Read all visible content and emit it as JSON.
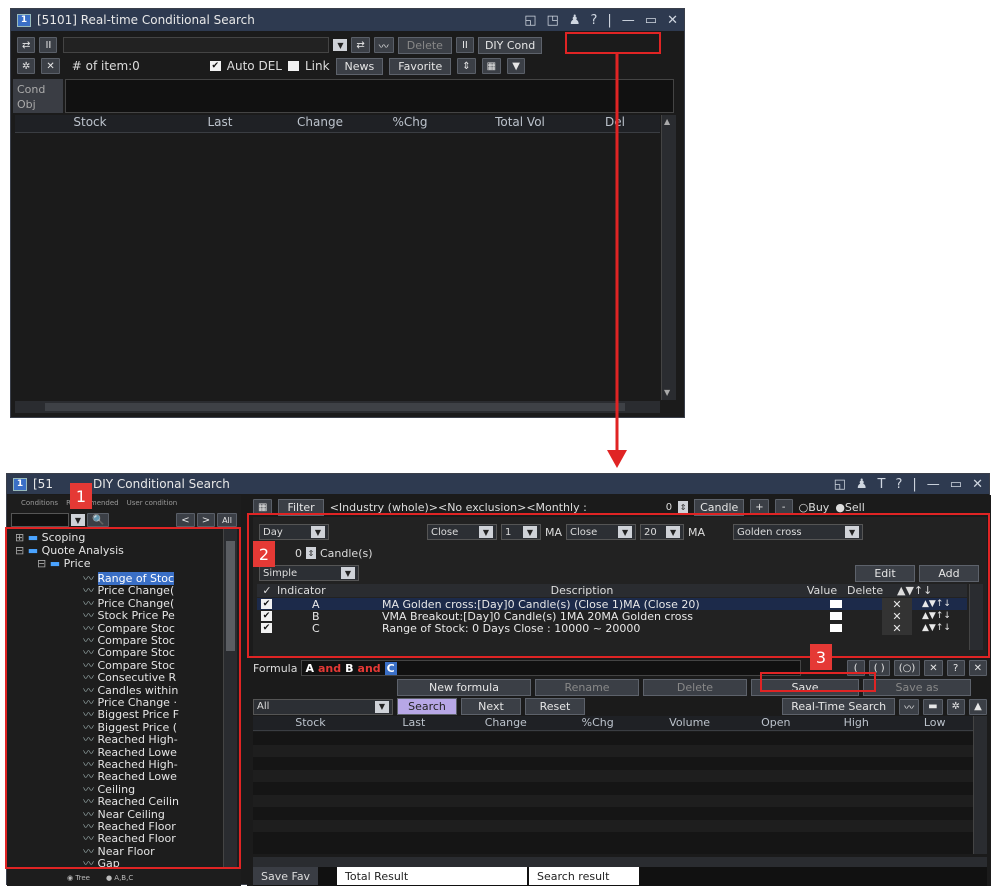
{
  "top": {
    "num": "1",
    "title": "[5101] Real-time Conditional Search",
    "ctrl": [
      "◱",
      "◳",
      "♟",
      "?",
      "|",
      "—",
      "▭",
      "✕"
    ],
    "toolbar1": {
      "swap": "⇄",
      "pause": "II",
      "arrow": "▼",
      "swap2": "⇄",
      "chart": "〰",
      "delete": "Delete",
      "pause2": "II",
      "diy": "DIY Cond"
    },
    "toolbar2": {
      "gear": "✲",
      "x": "✕",
      "items": "# of item:0",
      "autodel": "Auto DEL",
      "link": "Link",
      "news": "News",
      "favorite": "Favorite",
      "updown": "⇕",
      "more": "▦",
      "arrow": "▼"
    },
    "condobj": [
      "Cond",
      "Obj"
    ],
    "columns": [
      "Stock",
      "Last",
      "Change",
      "%Chg",
      "Total Vol",
      "Del"
    ]
  },
  "bottom": {
    "num": "1",
    "title_prefix": "[51",
    "title_suffix": "DIY Conditional Search",
    "ctrl": [
      "◱",
      "♟",
      "T",
      "?",
      "|",
      "—",
      "▭",
      "✕"
    ],
    "lefttabs": [
      "Conditions",
      "Recommended",
      "User condition"
    ],
    "leftbtns": [
      "<",
      ">",
      "All"
    ],
    "tree_roots": [
      "Scoping",
      "Quote Analysis",
      "Price"
    ],
    "tree_items": [
      "Range of Stoc",
      "Price Change(",
      "Price Change(",
      "Stock Price Pe",
      "Compare Stoc",
      "Compare Stoc",
      "Compare Stoc",
      "Compare Stoc",
      "Consecutive R",
      "Candles within",
      "Price Change ·",
      "Biggest Price F",
      "Biggest Price (",
      "Reached High-",
      "Reached Lowe",
      "Reached High-",
      "Reached Lowe",
      "Ceiling",
      "Reached Ceilin",
      "Near Ceiling",
      "Reached Floor",
      "Reached Floor",
      "Near Floor",
      "Gap"
    ],
    "radios": [
      "Tree",
      "A,B,C"
    ],
    "filter": {
      "btn": "Filter",
      "text": "<Industry (whole)><No exclusion><Monthly :",
      "zero": "0",
      "candle": "Candle",
      "plus": "+",
      "minus": "-",
      "buy": "Buy",
      "sell": "Sell"
    },
    "params": {
      "period": "Day",
      "close1": "Close",
      "one": "1",
      "ma1": "MA",
      "close2": "Close",
      "twenty": "20",
      "ma2": "MA",
      "cross": "Golden cross",
      "zero": "0",
      "candles": "Candle(s)",
      "mode": "Simple",
      "edit": "Edit",
      "add": "Add"
    },
    "ind_headers": {
      "check": "✓",
      "indicator": "Indicator",
      "description": "Description",
      "value": "Value",
      "delete": "Delete",
      "moves": "▲▼↑↓"
    },
    "indicators": [
      {
        "letter": "A",
        "desc": "MA Golden cross:[Day]0 Candle(s) (Close 1)MA (Close 20)"
      },
      {
        "letter": "B",
        "desc": "VMA Breakout:[Day]0 Candle(s) 1MA 20MA Golden cross"
      },
      {
        "letter": "C",
        "desc": "Range of Stock: 0 Days Close : 10000 ~ 20000"
      }
    ],
    "formula": {
      "label": "Formula",
      "a": "A",
      "and1": "and",
      "b": "B",
      "and2": "and",
      "c": "C"
    },
    "formula_tools": [
      "(",
      "( )",
      "(○)",
      "✕",
      "?",
      "✕"
    ],
    "actions": [
      "New formula",
      "Rename",
      "Delete",
      "Save",
      "Save as"
    ],
    "search_row": {
      "all": "All",
      "search": "Search",
      "next": "Next",
      "reset": "Reset",
      "rt": "Real-Time Search"
    },
    "columns": [
      "Stock",
      "Last",
      "Change",
      "%Chg",
      "Volume",
      "Open",
      "High",
      "Low"
    ],
    "bottom_tabs": [
      "Save Fav",
      "Total Result",
      "Search result"
    ]
  },
  "badges": [
    "1",
    "2",
    "3"
  ],
  "colors": {
    "accent_red": "#e02424",
    "badge": "#e53935",
    "title_bar": "#2e3a50"
  }
}
